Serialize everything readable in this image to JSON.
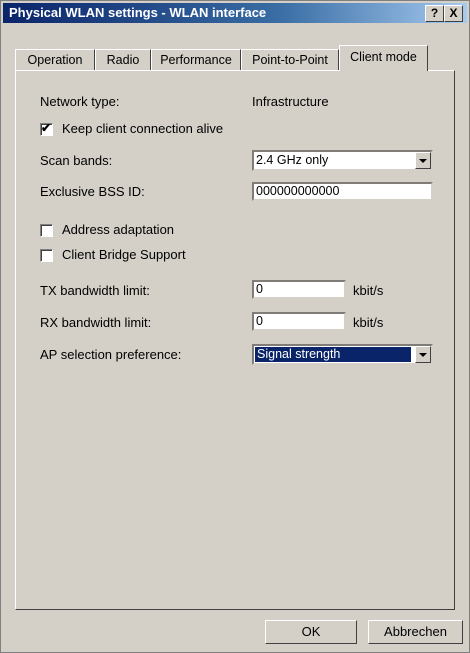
{
  "window": {
    "title": "Physical WLAN settings - WLAN interface",
    "help_label": "?",
    "close_label": "X"
  },
  "tabs": [
    "Operation",
    "Radio",
    "Performance",
    "Point-to-Point",
    "Client mode"
  ],
  "form": {
    "network_type_label": "Network type:",
    "network_type_value": "Infrastructure",
    "keep_alive_label": "Keep client connection alive",
    "keep_alive_checked": true,
    "scan_bands_label": "Scan bands:",
    "scan_bands_value": "2.4 GHz only",
    "bssid_label": "Exclusive BSS ID:",
    "bssid_value": "000000000000",
    "address_adaptation_label": "Address adaptation",
    "address_adaptation_checked": false,
    "client_bridge_label": "Client Bridge Support",
    "client_bridge_checked": false,
    "tx_label": "TX bandwidth limit:",
    "tx_value": "0",
    "tx_unit": "kbit/s",
    "rx_label": "RX bandwidth limit:",
    "rx_value": "0",
    "rx_unit": "kbit/s",
    "ap_pref_label": "AP selection preference:",
    "ap_pref_value": "Signal strength"
  },
  "buttons": {
    "ok": "OK",
    "cancel": "Abbrechen"
  },
  "check_glyph": "✔"
}
